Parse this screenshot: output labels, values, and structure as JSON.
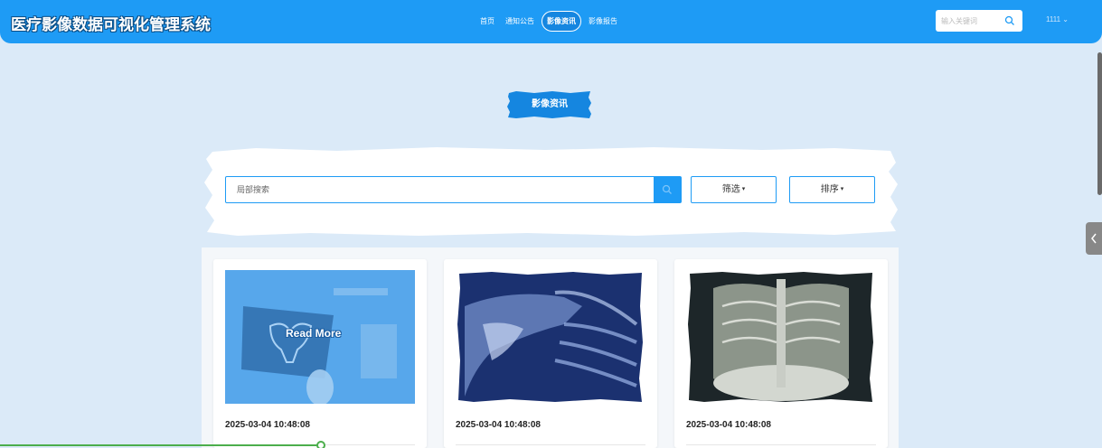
{
  "header": {
    "app_title": "医疗影像数据可视化管理系统",
    "nav": [
      "首页",
      "通知公告",
      "影像资讯",
      "影像报告"
    ],
    "active_nav": "影像资讯",
    "search_placeholder": "输入关键词",
    "user": "1111",
    "user_caret": "⌄",
    "bg_color": "#1e9bf5"
  },
  "section": {
    "title": "影像资讯"
  },
  "search": {
    "placeholder": "局部搜索",
    "filter_label": "筛选",
    "sort_label": "排序",
    "caret": "▾"
  },
  "cards": [
    {
      "date": "2025-03-04 10:48:08",
      "hover_label": "Read More",
      "icon": "pelvis-xray-image"
    },
    {
      "date": "2025-03-04 10:48:08",
      "icon": "shoulder-xray-image"
    },
    {
      "date": "2025-03-04 10:48:08",
      "icon": "chest-xray-image"
    }
  ],
  "icons": {
    "search": "search-icon",
    "side_tab": "chevron-left-icon"
  },
  "colors": {
    "accent": "#1e9bf5",
    "page_bg": "#dbeaf8",
    "section_title_bg": "#1586e0"
  }
}
